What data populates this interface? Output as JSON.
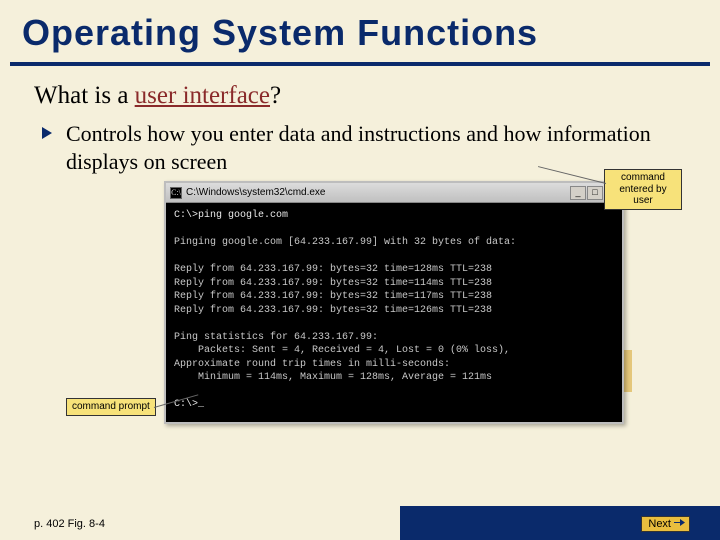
{
  "title": "Operating System Functions",
  "heading_prefix": "What is a ",
  "heading_keyword": "user interface",
  "heading_suffix": "?",
  "bullet": "Controls how you enter data and instructions and how information displays on screen",
  "callouts": {
    "user": "command\nentered by user",
    "prompt": "command prompt"
  },
  "cmd": {
    "title": "C:\\Windows\\system32\\cmd.exe",
    "btn_min": "_",
    "btn_max": "□",
    "btn_close": "×",
    "lines": {
      "l1": "C:\\>ping google.com",
      "l2": "",
      "l3": "Pinging google.com [64.233.167.99] with 32 bytes of data:",
      "l4": "",
      "l5": "Reply from 64.233.167.99: bytes=32 time=128ms TTL=238",
      "l6": "Reply from 64.233.167.99: bytes=32 time=114ms TTL=238",
      "l7": "Reply from 64.233.167.99: bytes=32 time=117ms TTL=238",
      "l8": "Reply from 64.233.167.99: bytes=32 time=126ms TTL=238",
      "l9": "",
      "l10": "Ping statistics for 64.233.167.99:",
      "l11": "    Packets: Sent = 4, Received = 4, Lost = 0 (0% loss),",
      "l12": "Approximate round trip times in milli-seconds:",
      "l13": "    Minimum = 114ms, Maximum = 128ms, Average = 121ms",
      "l14": "",
      "l15": "C:\\>_"
    }
  },
  "footer": {
    "page_ref": "p. 402 Fig. 8-4",
    "next": "Next"
  }
}
